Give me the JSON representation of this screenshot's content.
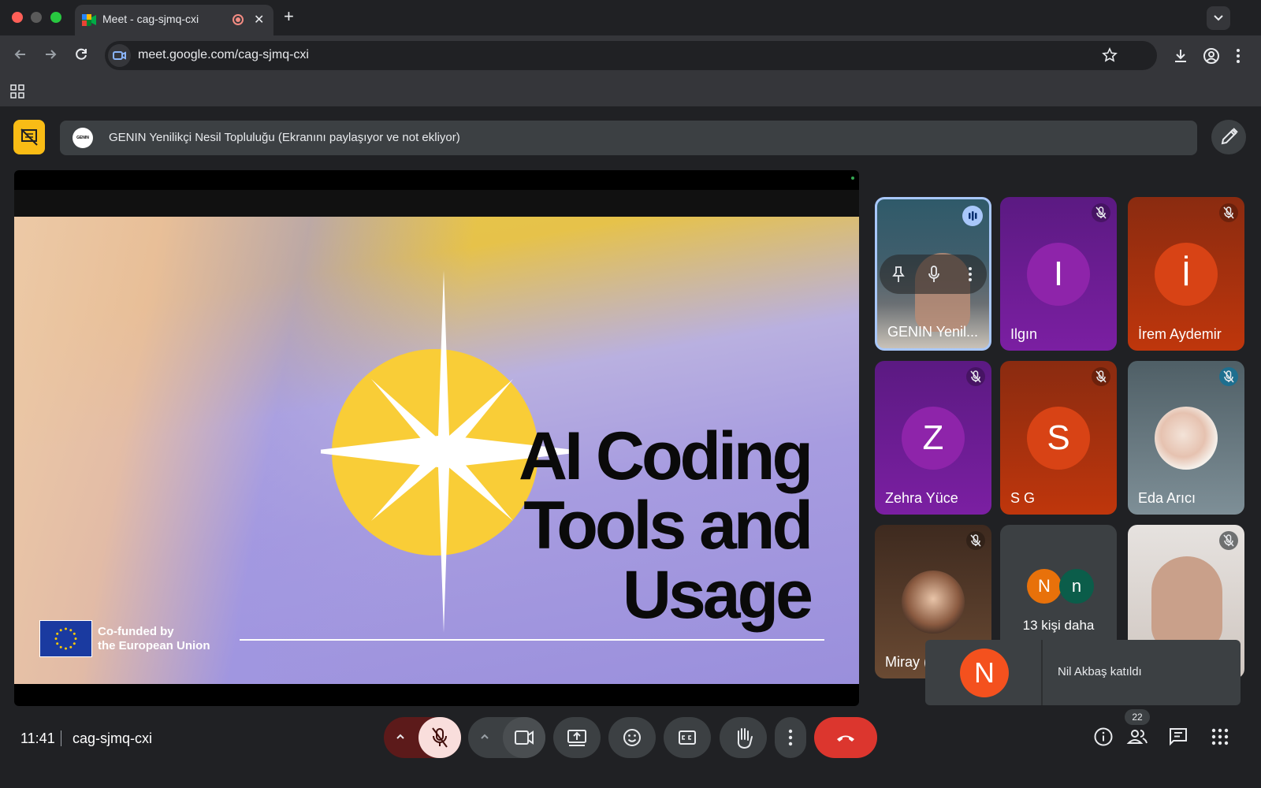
{
  "browser": {
    "tab_title": "Meet - cag-sjmq-cxi",
    "url": "meet.google.com/cag-sjmq-cxi"
  },
  "meet": {
    "presenter_banner": "GENIN Yenilikçi Nesil Topluluğu (Ekranını paylaşıyor ve not ekliyor)",
    "presenter_logo_text": "GENIN",
    "slide": {
      "title_line1": "AI Coding",
      "title_line2": "Tools and",
      "title_line3": "Usage",
      "eu_line1": "Co-funded by",
      "eu_line2": "the European Union"
    },
    "participants": [
      {
        "name": "GENIN Yenil...",
        "initial": "",
        "speaking": true
      },
      {
        "name": "Ilgın",
        "initial": "I",
        "color": "#7b1fa2"
      },
      {
        "name": "İrem Aydemir",
        "initial": "İ",
        "color": "#bf360c"
      },
      {
        "name": "Zehra Yüce",
        "initial": "Z",
        "color": "#7b1fa2"
      },
      {
        "name": "S G",
        "initial": "S",
        "color": "#bf360c"
      },
      {
        "name": "Eda Arıcı",
        "initial": "",
        "color": "#78909c"
      },
      {
        "name": "Miray (",
        "initial": "",
        "color": "#5d4037"
      },
      {
        "name": "13 kişi daha",
        "initial": "N",
        "initial2": "n"
      },
      {
        "name": "",
        "initial": ""
      }
    ],
    "toast": {
      "initial": "N",
      "text": "Nil Akbaş katıldı"
    },
    "bottom": {
      "time": "11:41",
      "meeting_code": "cag-sjmq-cxi",
      "people_count": "22"
    }
  }
}
